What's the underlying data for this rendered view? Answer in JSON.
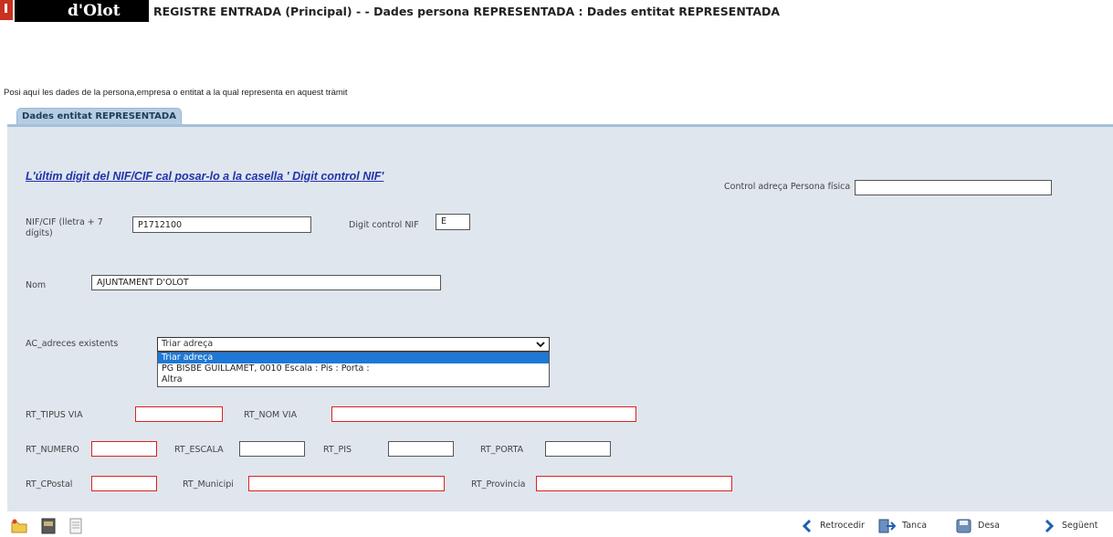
{
  "header": {
    "logo_text": "d'Olot",
    "title": "REGISTRE ENTRADA (Principal) - - Dades persona REPRESENTADA : Dades entitat REPRESENTADA"
  },
  "intro_text": "Posi aquí les dades de la persona,empresa o entitat a la qual representa en aquest tràmit",
  "tab_label": "Dades entitat REPRESENTADA",
  "note": "L'últim digit del NIF/CIF  cal posar-lo a la casella ' Digit control NIF'",
  "form": {
    "control_adreca_label": "Control adreça Persona física",
    "control_adreca_value": "",
    "nif_label_1": "NIF/CIF (lletra + 7",
    "nif_label_2": "dígits)",
    "nif_value": "P1712100",
    "digit_label": "Digit control NIF",
    "digit_value": "E",
    "nom_label": "Nom",
    "nom_value": "AJUNTAMENT D'OLOT",
    "adreces_label": "AC_adreces existents",
    "adreces_selected": "Triar adreça",
    "adreces_options": [
      "Triar adreça",
      "PG BISBE GUILLAMET, 0010 Escala : Pis : Porta :",
      "Altra"
    ],
    "tipus_via_label": "RT_TIPUS VIA",
    "nom_via_label": "RT_NOM VIA",
    "numero_label": "RT_NUMERO",
    "escala_label": "RT_ESCALA",
    "pis_label": "RT_PIS",
    "porta_label": "RT_PORTA",
    "cpostal_label": "RT_CPostal",
    "municipi_label": "RT_Municipi",
    "provincia_label": "RT_Provincia"
  },
  "footer": {
    "icons": [
      "folder-icon",
      "book-icon",
      "document-icon"
    ],
    "retrocedir": "Retrocedir",
    "tanca": "Tanca",
    "desa": "Desa",
    "seguent": "Següent"
  },
  "colors": {
    "panel": "#dfe6ee",
    "tab": "#b5cde2",
    "required_border": "#e02020",
    "link": "#2233aa",
    "selected_option": "#1e78d7"
  }
}
